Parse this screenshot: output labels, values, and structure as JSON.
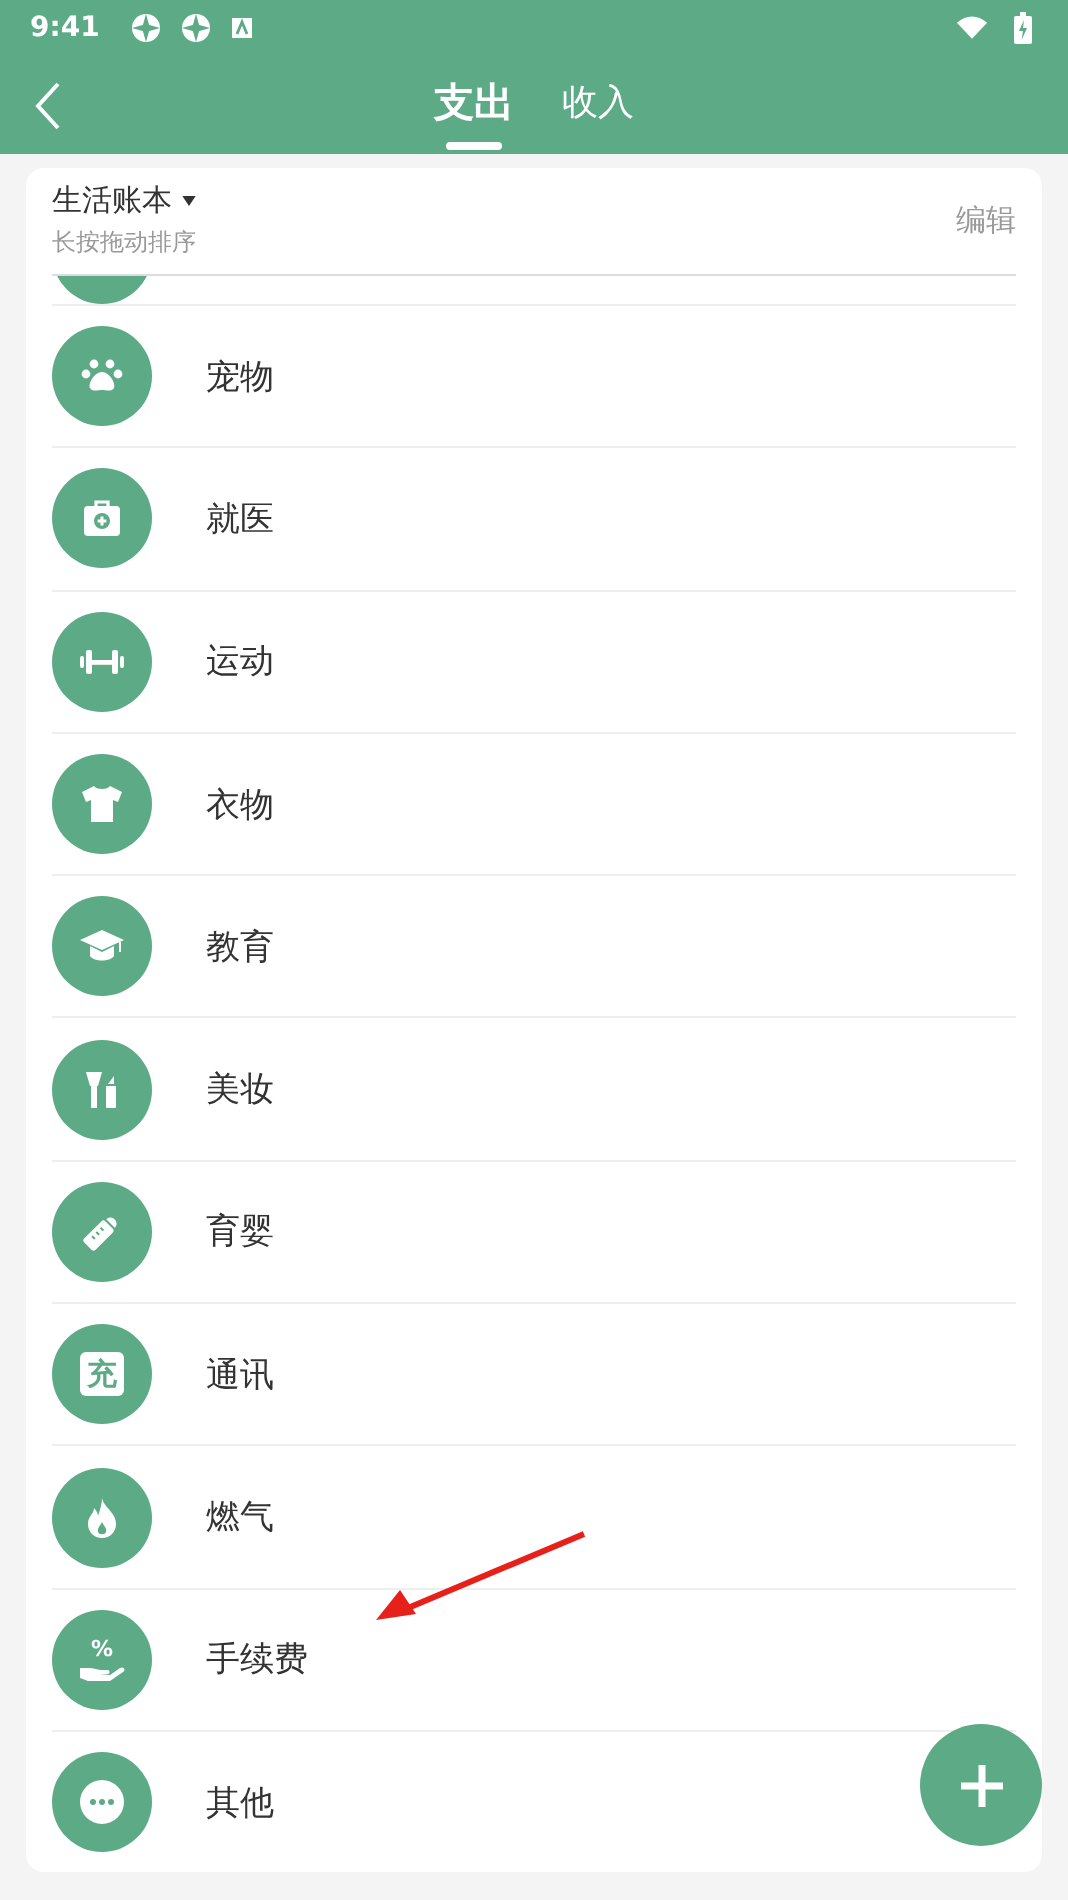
{
  "status_bar": {
    "time": "9:41"
  },
  "tabs": [
    {
      "label": "支出",
      "selected": true
    },
    {
      "label": "收入",
      "selected": false
    }
  ],
  "book": {
    "title": "生活账本",
    "hint": "长按拖动排序",
    "action": "编辑"
  },
  "categories": [
    {
      "label": "宠物",
      "kind": "paw"
    },
    {
      "label": "就医",
      "kind": "medkit"
    },
    {
      "label": "运动",
      "kind": "dumbbell"
    },
    {
      "label": "衣物",
      "kind": "shirt"
    },
    {
      "label": "教育",
      "kind": "cap"
    },
    {
      "label": "美妆",
      "kind": "makeup"
    },
    {
      "label": "育婴",
      "kind": "bottle"
    },
    {
      "label": "通讯",
      "kind": "glyph",
      "glyph": "充"
    },
    {
      "label": "燃气",
      "kind": "flame"
    },
    {
      "label": "手续费",
      "kind": "hand",
      "glyph": "%"
    },
    {
      "label": "其他",
      "kind": "more"
    }
  ]
}
